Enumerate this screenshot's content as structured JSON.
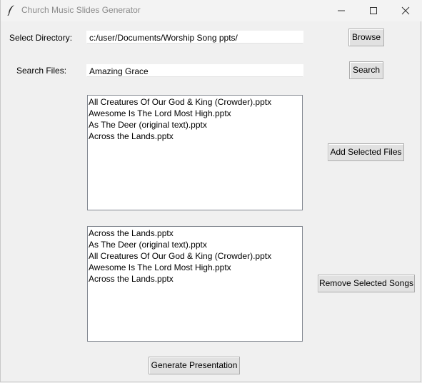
{
  "window": {
    "title": "Church Music Slides Generator"
  },
  "directory": {
    "label": "Select Directory:",
    "value": "c:/user/Documents/Worship Song ppts/",
    "browse_label": "Browse"
  },
  "search": {
    "label": "Search Files:",
    "value": "Amazing Grace",
    "button_label": "Search"
  },
  "files_list": {
    "items": [
      "All Creatures Of Our God & King (Crowder).pptx",
      "Awesome Is The Lord Most High.pptx",
      "As The Deer (original text).pptx",
      "Across the Lands.pptx"
    ],
    "add_label": "Add Selected Files"
  },
  "selected_list": {
    "items": [
      "Across the Lands.pptx",
      "As The Deer (original text).pptx",
      "All Creatures Of Our God & King (Crowder).pptx",
      "Awesome Is The Lord Most High.pptx",
      "Across the Lands.pptx"
    ],
    "remove_label": "Remove Selected Songs"
  },
  "generate_label": "Generate Presentation"
}
